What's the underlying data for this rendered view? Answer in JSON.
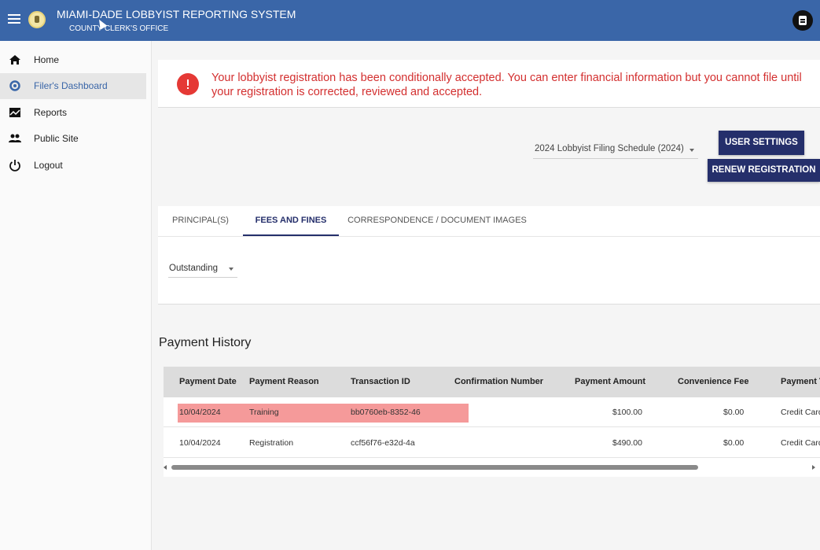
{
  "header": {
    "title": "MIAMI-DADE LOBBYIST REPORTING SYSTEM",
    "subtitle": "COUNTY CLERK'S OFFICE"
  },
  "sidebar": {
    "items": [
      {
        "label": "Home",
        "icon": "home-icon"
      },
      {
        "label": "Filer's Dashboard",
        "icon": "gear-icon",
        "active": true
      },
      {
        "label": "Reports",
        "icon": "chart-icon"
      },
      {
        "label": "Public Site",
        "icon": "people-icon"
      },
      {
        "label": "Logout",
        "icon": "power-icon"
      }
    ]
  },
  "alert": {
    "text": "Your lobbyist registration has been conditionally accepted. You can enter financial information but you cannot file until your registration is corrected, reviewed and accepted.",
    "color": "#d32f2f"
  },
  "controls": {
    "schedule": "2024 Lobbyist Filing Schedule (2024)",
    "user_settings": "USER SETTINGS",
    "renew_registration": "RENEW REGISTRATION"
  },
  "tabs": [
    {
      "label": "PRINCIPAL(S)"
    },
    {
      "label": "FEES AND FINES",
      "active": true
    },
    {
      "label": "CORRESPONDENCE / DOCUMENT IMAGES"
    }
  ],
  "status_filter": "Outstanding",
  "payment_history": {
    "title": "Payment History",
    "columns": [
      "Payment Date",
      "Payment Reason",
      "Transaction ID",
      "Confirmation Number",
      "Payment Amount",
      "Convenience Fee",
      "Payment T"
    ],
    "rows": [
      {
        "date": "10/04/2024",
        "reason": "Training",
        "transaction_id": "bb0760eb-8352-46",
        "confirmation": "",
        "amount": "$100.00",
        "fee": "$0.00",
        "type": "Credit Card",
        "highlighted": true
      },
      {
        "date": "10/04/2024",
        "reason": "Registration",
        "transaction_id": "ccf56f76-e32d-4a",
        "confirmation": "",
        "amount": "$490.00",
        "fee": "$0.00",
        "type": "Credit Card",
        "highlighted": false
      }
    ]
  },
  "colors": {
    "header": "#3a66a8",
    "primary_button": "#252f6b",
    "row_highlight": "#f59a9a"
  }
}
